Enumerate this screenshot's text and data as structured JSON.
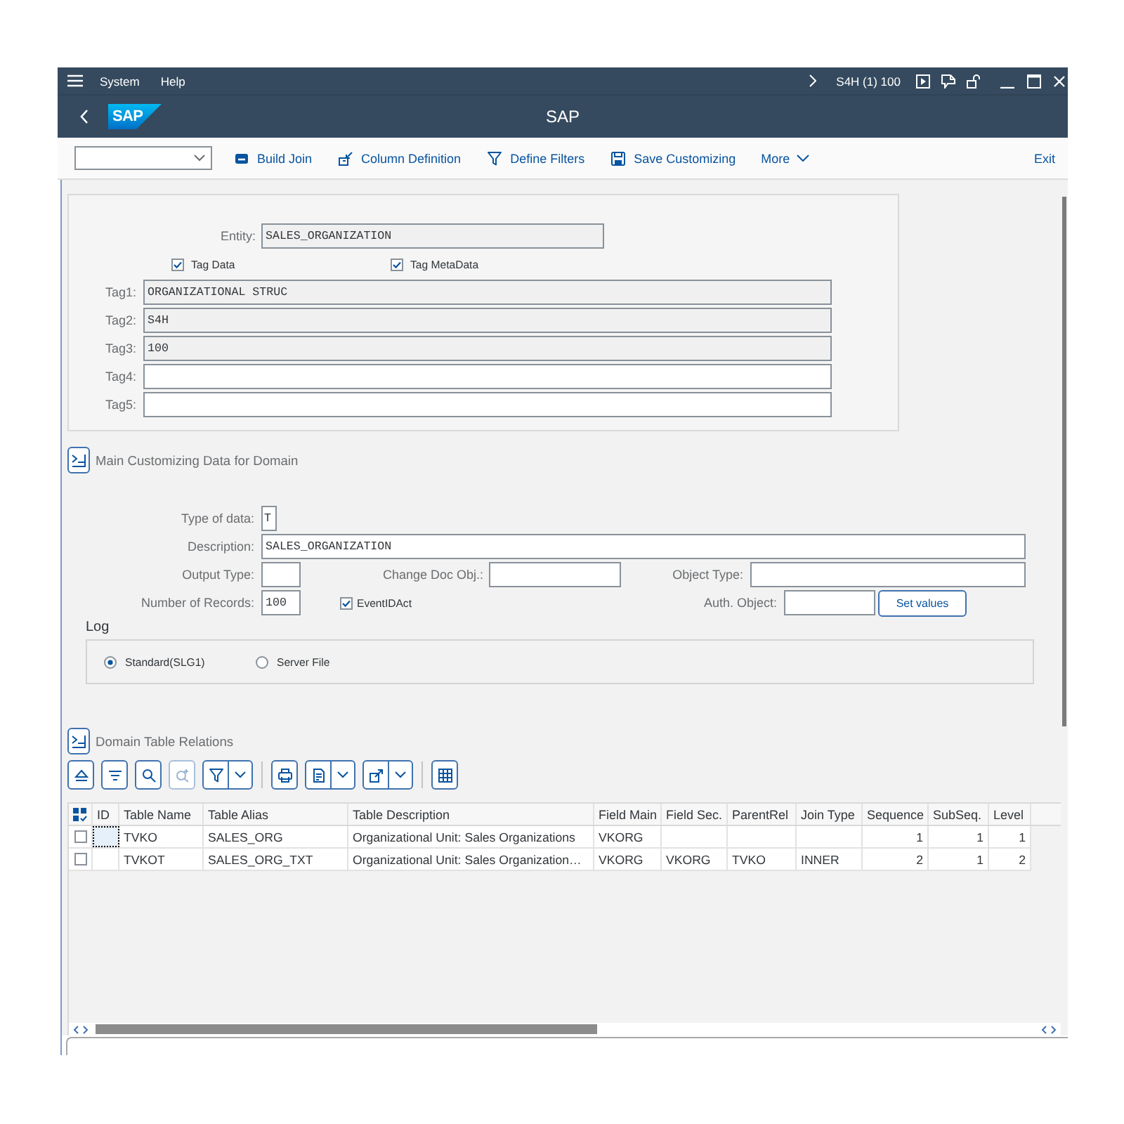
{
  "menu_bar": {
    "items": [
      "System",
      "Help"
    ],
    "system_info": "S4H (1) 100"
  },
  "title_bar": {
    "logo": "SAP",
    "title": "SAP"
  },
  "toolbar": {
    "buttons": [
      "Build Join",
      "Column Definition",
      "Define Filters",
      "Save Customizing"
    ],
    "more": "More",
    "exit": "Exit"
  },
  "entity_panel": {
    "entity": {
      "label": "Entity:",
      "value": "SALES_ORGANIZATION",
      "readonly": true
    },
    "checkboxes": [
      {
        "label": "Tag Data",
        "checked": true
      },
      {
        "label": "Tag MetaData",
        "checked": true
      }
    ],
    "tags": [
      {
        "label": "Tag1:",
        "value": "ORGANIZATIONAL STRUC",
        "readonly": true
      },
      {
        "label": "Tag2:",
        "value": "S4H",
        "readonly": true
      },
      {
        "label": "Tag3:",
        "value": "100",
        "readonly": true
      },
      {
        "label": "Tag4:",
        "readonly": false
      },
      {
        "label": "Tag5:",
        "readonly": false
      }
    ]
  },
  "main_section": {
    "title": "Main Customizing Data for Domain",
    "type_of_data": {
      "label": "Type of data:",
      "value": "T"
    },
    "description": {
      "label": "Description:",
      "value": "SALES_ORGANIZATION"
    },
    "output_type": {
      "label": "Output Type:"
    },
    "change_doc_obj": {
      "label": "Change Doc Obj.:"
    },
    "object_type": {
      "label": "Object Type:"
    },
    "number_of_records": {
      "label": "Number of Records:",
      "value": "100"
    },
    "event_id_act": {
      "label": "EventIDAct",
      "checked": true
    },
    "auth_object": {
      "label": "Auth. Object:"
    },
    "set_values_button": "Set values"
  },
  "log": {
    "title": "Log",
    "options": [
      {
        "label": "Standard(SLG1)",
        "selected": true
      },
      {
        "label": "Server File",
        "selected": false
      }
    ]
  },
  "relations_section": {
    "title": "Domain Table Relations",
    "toolbar": [
      {
        "disabled": false,
        "menu": false
      },
      {
        "disabled": false,
        "menu": false
      },
      {
        "disabled": false,
        "menu": false
      },
      {
        "disabled": true,
        "menu": false
      },
      {
        "disabled": false,
        "menu": true
      },
      {
        "disabled": false,
        "menu": false
      },
      {
        "disabled": false,
        "menu": true
      },
      {
        "disabled": false,
        "menu": true
      },
      {
        "disabled": false,
        "menu": false
      }
    ],
    "table": {
      "columns": [
        "ID",
        "Table Name",
        "Table Alias",
        "Table Description",
        "Field Main",
        "Field Sec.",
        "ParentRel",
        "Join Type",
        "Sequence",
        "SubSeq.",
        "Level"
      ],
      "rows": [
        {
          "selected": false,
          "focused": true,
          "cells": [
            null,
            "TVKO",
            "SALES_ORG",
            "Organizational Unit: Sales Organizations",
            "VKORG",
            null,
            null,
            null,
            "1",
            "1",
            "1"
          ]
        },
        {
          "selected": false,
          "focused": false,
          "cells": [
            null,
            "TVKOT",
            "SALES_ORG_TXT",
            "Organizational Unit: Sales Organization…",
            "VKORG",
            "VKORG",
            "TVKO",
            "INNER",
            "2",
            "1",
            "2"
          ]
        }
      ]
    }
  }
}
